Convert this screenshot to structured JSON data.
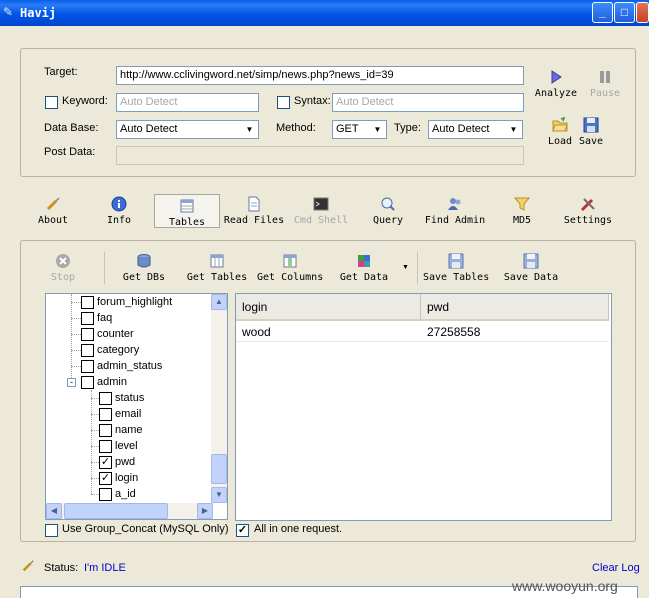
{
  "window": {
    "title": "Havij"
  },
  "target": {
    "target_label": "Target:",
    "target_value": "http://www.cclivingword.net/simp/news.php?news_id=39",
    "keyword_label": "Keyword:",
    "keyword_placeholder": "Auto Detect",
    "syntax_label": "Syntax:",
    "syntax_placeholder": "Auto Detect",
    "database_label": "Data Base:",
    "database_value": "Auto Detect",
    "method_label": "Method:",
    "method_value": "GET",
    "type_label": "Type:",
    "type_value": "Auto Detect",
    "postdata_label": "Post Data:",
    "analyze": "Analyze",
    "pause": "Pause",
    "load": "Load",
    "save": "Save"
  },
  "tabs": [
    {
      "label": "About"
    },
    {
      "label": "Info"
    },
    {
      "label": "Tables"
    },
    {
      "label": "Read Files"
    },
    {
      "label": "Cmd Shell"
    },
    {
      "label": "Query"
    },
    {
      "label": "Find Admin"
    },
    {
      "label": "MD5"
    },
    {
      "label": "Settings"
    }
  ],
  "toolbar": {
    "stop": "Stop",
    "get_dbs": "Get DBs",
    "get_tables": "Get Tables",
    "get_columns": "Get Columns",
    "get_data": "Get Data",
    "save_tables": "Save Tables",
    "save_data": "Save Data"
  },
  "tree": {
    "tables": [
      "forum_highlight",
      "faq",
      "counter",
      "category",
      "admin_status",
      "admin"
    ],
    "columns": [
      {
        "name": "status",
        "checked": false
      },
      {
        "name": "email",
        "checked": false
      },
      {
        "name": "name",
        "checked": false
      },
      {
        "name": "level",
        "checked": false
      },
      {
        "name": "pwd",
        "checked": true
      },
      {
        "name": "login",
        "checked": true
      },
      {
        "name": "a_id",
        "checked": false
      }
    ]
  },
  "grid": {
    "columns": [
      "login",
      "pwd"
    ],
    "rows": [
      [
        "wood",
        "27258558"
      ]
    ]
  },
  "options": {
    "group_concat": "Use Group_Concat (MySQL Only)",
    "all_in_one": "All in one request."
  },
  "status": {
    "label": "Status:",
    "value": "I'm IDLE",
    "clear_log": "Clear Log"
  },
  "watermark": "www.wooyun.org",
  "colors": {
    "titlebar": "#0055E5",
    "status_link": "#0000CC",
    "panel": "#ECE9D8"
  }
}
